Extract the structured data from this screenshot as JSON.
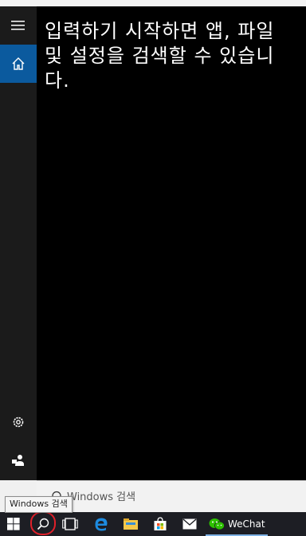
{
  "search_panel": {
    "hint_text": "입력하기 시작하면 앱, 파일 및 설정을 검색할 수 있습니다.",
    "search_placeholder": "Windows 검색"
  },
  "tooltip": {
    "text": "Windows 검색"
  },
  "sidebar": {
    "items": [
      {
        "icon": "hamburger-menu-icon"
      },
      {
        "icon": "home-icon",
        "active": true
      },
      {
        "icon": "settings-gear-icon"
      },
      {
        "icon": "user-feedback-icon"
      }
    ]
  },
  "taskbar": {
    "items": [
      {
        "icon": "windows-start-icon"
      },
      {
        "icon": "search-icon"
      },
      {
        "icon": "task-view-icon"
      },
      {
        "icon": "edge-browser-icon"
      },
      {
        "icon": "file-explorer-icon"
      },
      {
        "icon": "store-icon"
      },
      {
        "icon": "mail-icon"
      },
      {
        "icon": "wechat-icon",
        "label": "WeChat"
      }
    ],
    "wechat_label": "WeChat"
  },
  "colors": {
    "sidebar_bg": "#1b1b1b",
    "active_blue": "#0b5a9e",
    "panel_bg": "#000000",
    "taskbar_bg": "#1d1e24",
    "highlight_red": "#e0202a"
  }
}
